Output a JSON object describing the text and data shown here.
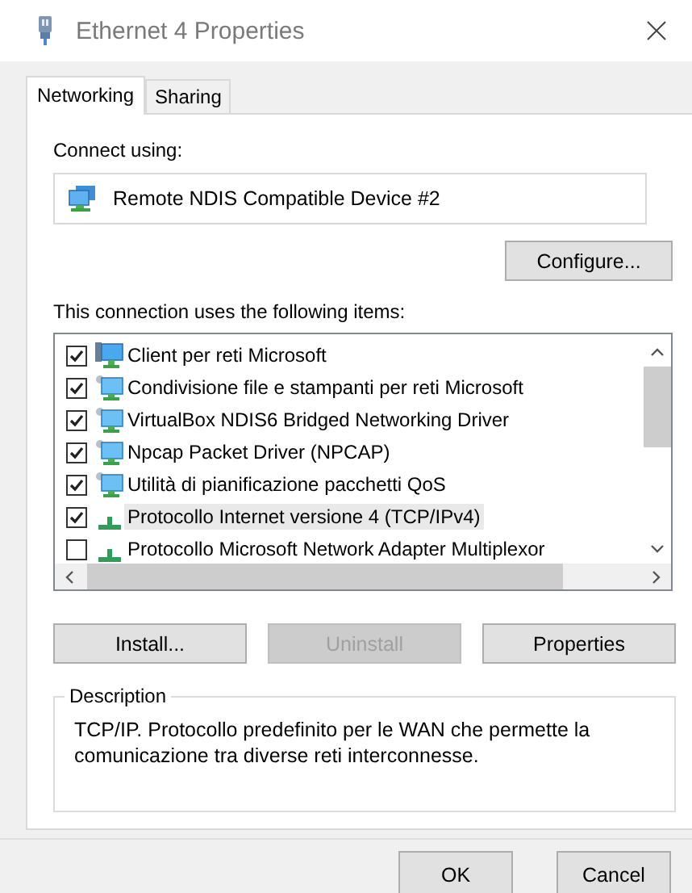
{
  "window": {
    "title": "Ethernet 4 Properties"
  },
  "tabs": [
    {
      "label": "Networking",
      "selected": true
    },
    {
      "label": "Sharing",
      "selected": false
    }
  ],
  "connect_using": {
    "label": "Connect using:",
    "device": "Remote NDIS Compatible Device #2"
  },
  "configure_button": "Configure...",
  "items_label": "This connection uses the following items:",
  "items": [
    {
      "label": "Client per reti Microsoft",
      "checked": true,
      "selected": false,
      "kind": "client"
    },
    {
      "label": "Condivisione file e stampanti per reti Microsoft",
      "checked": true,
      "selected": false,
      "kind": "service"
    },
    {
      "label": "VirtualBox NDIS6 Bridged Networking Driver",
      "checked": true,
      "selected": false,
      "kind": "service"
    },
    {
      "label": "Npcap Packet Driver (NPCAP)",
      "checked": true,
      "selected": false,
      "kind": "service"
    },
    {
      "label": "Utilità di pianificazione pacchetti QoS",
      "checked": true,
      "selected": false,
      "kind": "service"
    },
    {
      "label": "Protocollo Internet versione 4 (TCP/IPv4)",
      "checked": true,
      "selected": true,
      "kind": "protocol"
    },
    {
      "label": "Protocollo Microsoft Network Adapter Multiplexor",
      "checked": false,
      "selected": false,
      "kind": "protocol"
    }
  ],
  "item_buttons": [
    {
      "label": "Install...",
      "disabled": false
    },
    {
      "label": "Uninstall",
      "disabled": true
    },
    {
      "label": "Properties",
      "disabled": false
    }
  ],
  "description": {
    "title": "Description",
    "text": "TCP/IP. Protocollo predefinito per le WAN che permette la comunicazione tra diverse reti interconnesse."
  },
  "dialog_buttons": [
    "OK",
    "Cancel"
  ]
}
